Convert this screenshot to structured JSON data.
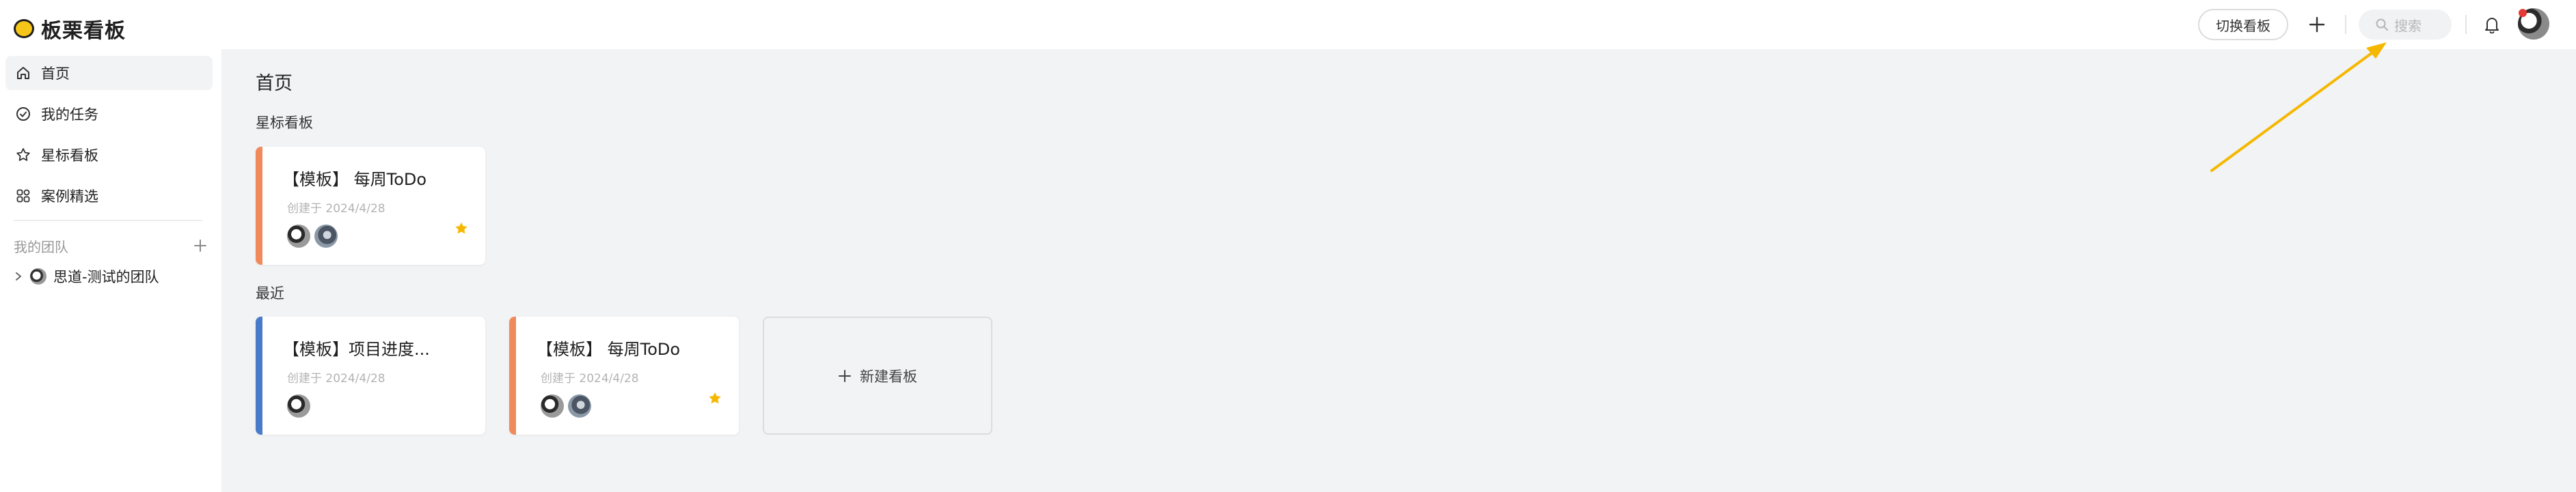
{
  "app": {
    "title": "板栗看板",
    "accent": "#f5c518"
  },
  "header": {
    "switch_label": "切换看板",
    "search_placeholder": "搜索",
    "avatar_badge_color": "#e53935"
  },
  "sidebar": {
    "items": [
      {
        "label": "首页",
        "icon": "home-icon",
        "active": true
      },
      {
        "label": "我的任务",
        "icon": "check-circle-icon",
        "active": false
      },
      {
        "label": "星标看板",
        "icon": "star-outline-icon",
        "active": false
      },
      {
        "label": "案例精选",
        "icon": "grid-icon",
        "active": false
      }
    ],
    "team_section_label": "我的团队",
    "teams": [
      {
        "name": "思道-测试的团队"
      }
    ]
  },
  "main": {
    "page_title": "首页",
    "starred_label": "星标看板",
    "recent_label": "最近",
    "starred_boards": [
      {
        "title": "【模板】 每周ToDo",
        "created": "创建于 2024/4/28",
        "accent": "#f08a5d",
        "starred": true
      }
    ],
    "recent_boards": [
      {
        "title": "【模板】项目进度...",
        "created": "创建于 2024/4/28",
        "accent": "#4a7bc8",
        "starred": false
      },
      {
        "title": "【模板】 每周ToDo",
        "created": "创建于 2024/4/28",
        "accent": "#f08a5d",
        "starred": true
      }
    ],
    "new_board_label": "新建看板"
  }
}
